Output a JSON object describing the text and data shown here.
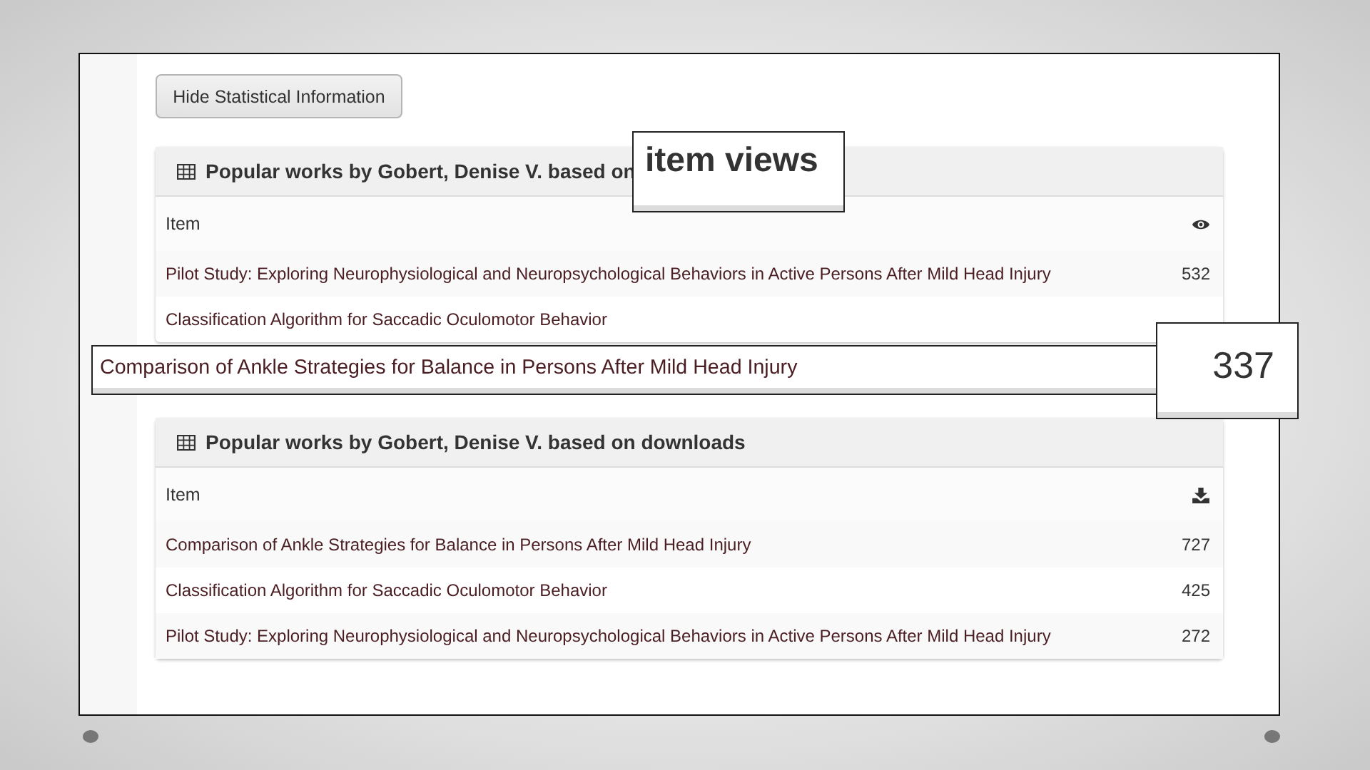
{
  "button": {
    "label": "Hide Statistical Information"
  },
  "panels": [
    {
      "title": "Popular works by Gobert, Denise V. based on",
      "column_1": "Item",
      "kind": "views",
      "rows": [
        {
          "title": "Pilot Study: Exploring Neurophysiological and Neuropsychological Behaviors in Active Persons After Mild Head Injury",
          "count": "532"
        },
        {
          "title": "Classification Algorithm for Saccadic Oculomotor Behavior"
        }
      ]
    },
    {
      "title": "Popular works by Gobert, Denise V. based on downloads",
      "column_1": "Item",
      "kind": "downloads",
      "rows": [
        {
          "title": "Comparison of Ankle Strategies for Balance in Persons After Mild Head Injury",
          "count": "727"
        },
        {
          "title": "Classification Algorithm for Saccadic Oculomotor Behavior",
          "count": "425"
        },
        {
          "title": "Pilot Study: Exploring Neurophysiological and Neuropsychological Behaviors in Active Persons After Mild Head Injury",
          "count": "272"
        }
      ]
    }
  ],
  "callouts": [
    {
      "kind": "heading",
      "text": "item views"
    },
    {
      "kind": "row",
      "text": "Comparison of Ankle Strategies for Balance in Persons After Mild Head Injury"
    },
    {
      "kind": "count",
      "text": "337"
    }
  ]
}
